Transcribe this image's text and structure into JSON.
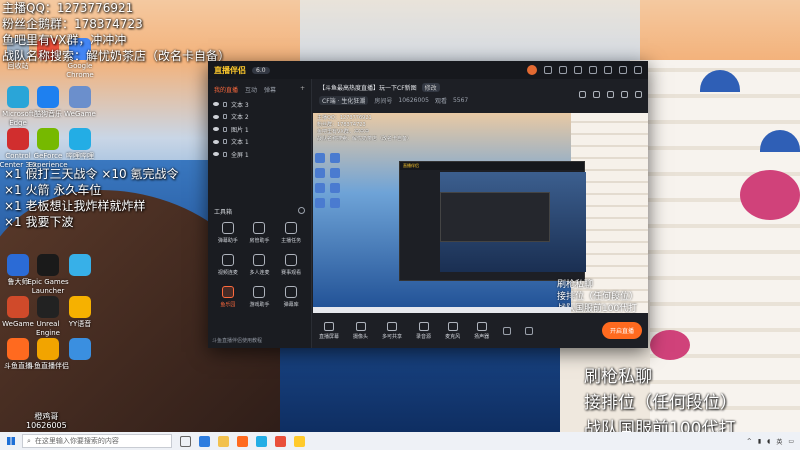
{
  "overlay": {
    "top_lines": [
      "主播QQ：1273776921",
      "粉丝企鹅群：178374723",
      "鱼吧里有VX群，冲冲冲",
      "战队名称搜索：解忧奶茶店（改名卡自备）"
    ],
    "mid_lines": [
      "×1 假打三天战令 ×10 氪完战令",
      "×1 火箭 永久车位",
      "×1 老板想让我炸样就炸样",
      "×1 我要下波"
    ],
    "br_lines": [
      "刷枪私聊",
      "接排位（任何段位）",
      "战队国服前100代打"
    ]
  },
  "desktop_icons": [
    {
      "label": "回收站",
      "color": "#9fb3c8"
    },
    {
      "label": "",
      "color": "#e94f3a"
    },
    {
      "label": "Google Chrome",
      "color": "#4285f4"
    },
    {
      "label": "Microsoft Edge",
      "color": "#2aa5d8"
    },
    {
      "label": "酷狗音乐",
      "color": "#1e80f0"
    },
    {
      "label": "WeGame",
      "color": "#6b8fcc"
    },
    {
      "label": "Control Center 3.0",
      "color": "#d12e2e"
    },
    {
      "label": "GeForce Experience",
      "color": "#76b900"
    },
    {
      "label": "哔哩哔哩",
      "color": "#23ade5"
    },
    {
      "label": "鲁大师",
      "color": "#2b6bd6"
    },
    {
      "label": "Epic Games Launcher",
      "color": "#1a1a1a"
    },
    {
      "label": "",
      "color": "#37b0e8"
    },
    {
      "label": "WeGame",
      "color": "#d04a2a"
    },
    {
      "label": "Unreal Engine",
      "color": "#222"
    },
    {
      "label": "YY语音",
      "color": "#f6b100"
    },
    {
      "label": "斗鱼直播",
      "color": "#ff6a1f"
    },
    {
      "label": "斗鱼直播伴侣",
      "color": "#f2a400"
    },
    {
      "label": "",
      "color": "#3a8fe0"
    }
  ],
  "desktop_corner": {
    "name": "橙鸡哥",
    "id": "10626005"
  },
  "app": {
    "logo_text": "直播伴侣",
    "version": "6.0",
    "sidebar_tabs": [
      {
        "label": "我的直播",
        "active": true
      },
      {
        "label": "互动",
        "active": false
      },
      {
        "label": "弹幕",
        "active": false
      }
    ],
    "scenes": [
      "文本 3",
      "文本 2",
      "图片 1",
      "文本 1",
      "全屏 1"
    ],
    "tools_title": "工具箱",
    "tools": [
      {
        "label": "弹幕助手",
        "hot": false
      },
      {
        "label": "房管助手",
        "hot": false
      },
      {
        "label": "主播任务",
        "hot": false
      },
      {
        "label": "视频连麦",
        "hot": false
      },
      {
        "label": "多人连麦",
        "hot": false
      },
      {
        "label": "赛事观看",
        "hot": false
      },
      {
        "label": "鱼乐园",
        "hot": true
      },
      {
        "label": "游戏助手",
        "hot": false
      },
      {
        "label": "弹幕库",
        "hot": false
      }
    ],
    "sidebar_footer": "斗鱼直播伴侣使用教程",
    "stream_title": "【斗鱼最高热度直播】玩一下CF新图",
    "edit_label": "修改",
    "category": "CF端 · 生化狂潮",
    "room_label": "房间号",
    "room_id": "10626005",
    "viewers_label": "观看",
    "viewers": "5567",
    "preview_text": [
      "主播QQ：1273776921",
      "粉丝群：178374723",
      "鱼吧里有VX群，冲冲冲",
      "战队名称搜索：解忧奶茶店（改名卡自备）"
    ],
    "preview_br": [
      "刷枪私聊",
      "接排位（任何段位）",
      "战队国服前100代打"
    ],
    "controls": [
      {
        "label": "直播屏幕"
      },
      {
        "label": "摄像头"
      },
      {
        "label": "多可共享"
      },
      {
        "label": "录音源"
      },
      {
        "label": "麦克风"
      },
      {
        "label": "扬声器"
      }
    ],
    "start_button": "开启直播"
  },
  "taskbar": {
    "search_placeholder": "在这里输入你要搜索的内容",
    "apps": [
      "#2d7de0",
      "#f2c14e",
      "#ff6a1f",
      "#23ade5",
      "#e94f3a",
      "#ffca2c"
    ],
    "tray_time": "",
    "tray_text": "英"
  }
}
